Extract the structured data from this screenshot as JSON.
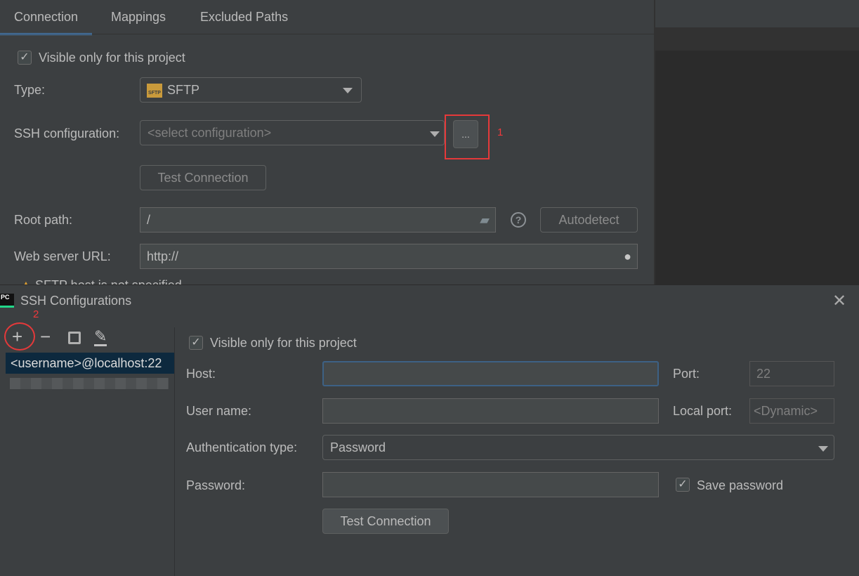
{
  "tabs": [
    {
      "label": "Connection",
      "active": true
    },
    {
      "label": "Mappings"
    },
    {
      "label": "Excluded Paths"
    }
  ],
  "connection": {
    "visible_only": {
      "label": "Visible only for this project",
      "checked": true
    },
    "type": {
      "label": "Type:",
      "value": "SFTP",
      "icon": "sftp-icon"
    },
    "ssh": {
      "label": "SSH configuration:",
      "placeholder": "<select configuration>",
      "browse_label": "...",
      "annotation": "1"
    },
    "test_connection": "Test Connection",
    "root_path": {
      "label": "Root path:",
      "value": "/",
      "autodetect": "Autodetect"
    },
    "web_url": {
      "label": "Web server URL:",
      "value": "http://"
    },
    "warning": "SFTP host is not specified"
  },
  "dialog": {
    "title": "SSH Configurations",
    "annotation": "2",
    "toolbar": [
      "add-icon",
      "remove-icon",
      "copy-icon",
      "edit-icon"
    ],
    "list": [
      {
        "label": "<username>@localhost:22",
        "selected": true
      }
    ],
    "visible_only": {
      "label": "Visible only for this project",
      "checked": true
    },
    "host": {
      "label": "Host:",
      "value": ""
    },
    "port": {
      "label": "Port:",
      "value": "22"
    },
    "user": {
      "label": "User name:",
      "value": ""
    },
    "local_port": {
      "label": "Local port:",
      "placeholder": "<Dynamic>"
    },
    "auth": {
      "label": "Authentication type:",
      "value": "Password"
    },
    "password": {
      "label": "Password:",
      "value": ""
    },
    "save_password": {
      "label": "Save password",
      "checked": true
    },
    "test_connection": "Test Connection"
  },
  "colors": {
    "accent": "#4a88c7",
    "annotation": "#e5393a",
    "selection": "#0d293e"
  }
}
